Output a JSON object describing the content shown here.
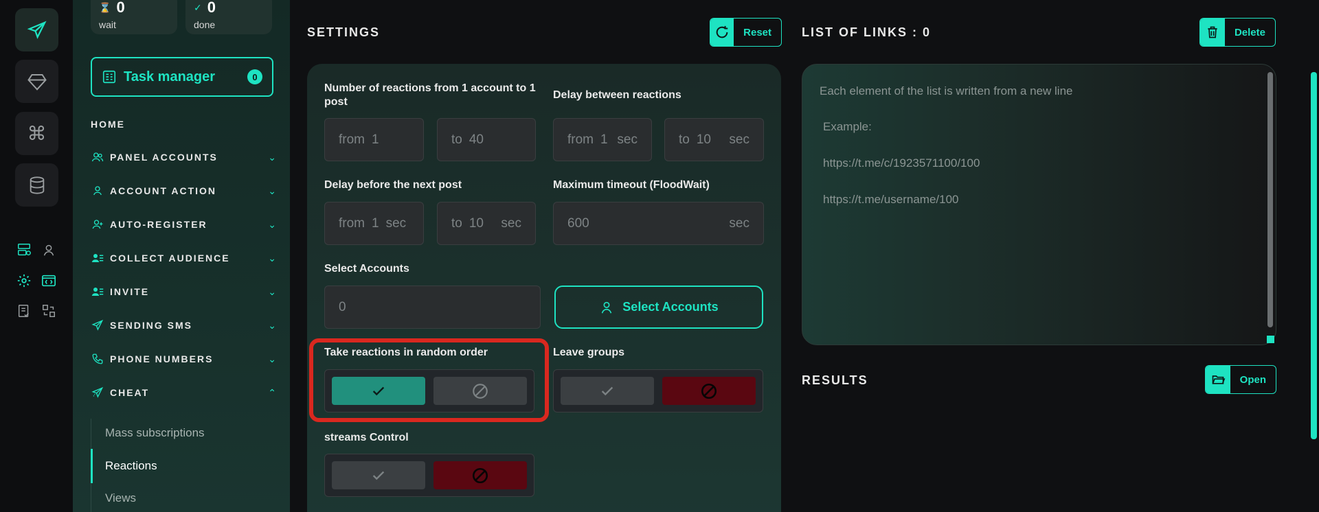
{
  "stats": [
    {
      "value": "0",
      "label": "wait",
      "icon": "hourglass-icon"
    },
    {
      "value": "0",
      "label": "done",
      "icon": "check-circle-icon"
    }
  ],
  "task_manager": {
    "label": "Task manager",
    "count": "0"
  },
  "nav": {
    "home": "HOME",
    "items": [
      {
        "label": "PANEL ACCOUNTS",
        "icon": "users-icon"
      },
      {
        "label": "ACCOUNT ACTION",
        "icon": "user-icon"
      },
      {
        "label": "AUTO-REGISTER",
        "icon": "user-plus-icon"
      },
      {
        "label": "COLLECT AUDIENCE",
        "icon": "user-list-icon"
      },
      {
        "label": "INVITE",
        "icon": "user-list-icon"
      },
      {
        "label": "SENDING SMS",
        "icon": "send-icon"
      },
      {
        "label": "PHONE NUMBERS",
        "icon": "phone-icon"
      },
      {
        "label": "CHEAT",
        "icon": "send-stars-icon"
      }
    ],
    "subitems": [
      "Mass subscriptions",
      "Reactions",
      "Views"
    ]
  },
  "settings": {
    "title": "SETTINGS",
    "reset": "Reset",
    "reactions_label": "Number of reactions from 1 account to 1 post",
    "reactions_from": {
      "prefix": "from",
      "value": "1"
    },
    "reactions_to": {
      "prefix": "to",
      "value": "40"
    },
    "delay_between_label": "Delay between reactions",
    "delay_between_from": {
      "prefix": "from",
      "value": "1",
      "unit": "sec"
    },
    "delay_between_to": {
      "prefix": "to",
      "value": "10",
      "unit": "sec"
    },
    "delay_next_label": "Delay before the next post",
    "delay_next_from": {
      "prefix": "from",
      "value": "1",
      "unit": "sec"
    },
    "delay_next_to": {
      "prefix": "to",
      "value": "10",
      "unit": "sec"
    },
    "timeout_label": "Maximum timeout (FloodWait)",
    "timeout": {
      "value": "600",
      "unit": "sec"
    },
    "select_accounts_label": "Select Accounts",
    "select_accounts_value": "0",
    "select_accounts_button": "Select Accounts",
    "random_order_label": "Take reactions in random order",
    "leave_groups_label": "Leave groups",
    "streams_label": "streams Control"
  },
  "links": {
    "title": "LIST OF LINKS : 0",
    "delete": "Delete",
    "placeholder": "Each element of the list is written from a new line",
    "example_label": "Example:",
    "example_1": "https://t.me/c/1923571100/100",
    "example_2": "https://t.me/username/100"
  },
  "results": {
    "title": "RESULTS",
    "open": "Open"
  },
  "colors": {
    "accent": "#1ee3c2",
    "toggle_on": "#21907d",
    "toggle_off_red": "#5a0711",
    "highlight": "#d9281f"
  }
}
